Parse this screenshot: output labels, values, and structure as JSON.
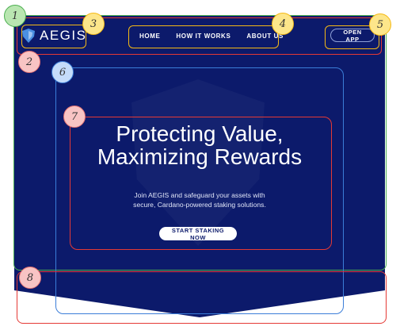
{
  "brand": {
    "name": "AEGIS",
    "logo_icon": "shield-logo-icon"
  },
  "nav": {
    "items": [
      {
        "label": "HOME"
      },
      {
        "label": "HOW IT WORKS"
      },
      {
        "label": "ABOUT US"
      }
    ],
    "open_app_label": "OPEN APP"
  },
  "hero": {
    "headline_line1": "Protecting Value,",
    "headline_line2": "Maximizing Rewards",
    "subtext_line1": "Join AEGIS and safeguard your assets with",
    "subtext_line2": "secure, Cardano-powered staking solutions.",
    "cta_label": "START STAKING NOW"
  },
  "annotations": [
    {
      "label": "1",
      "color": "#4caf50"
    },
    {
      "label": "2",
      "color": "#e53935"
    },
    {
      "label": "3",
      "color": "#f5b915"
    },
    {
      "label": "4",
      "color": "#f5b915"
    },
    {
      "label": "5",
      "color": "#f5b915"
    },
    {
      "label": "6",
      "color": "#3b7dd8"
    },
    {
      "label": "7",
      "color": "#e53935"
    },
    {
      "label": "8",
      "color": "#e53935"
    }
  ],
  "colors": {
    "background": "#0c1a6b",
    "text": "#ffffff",
    "accent_logo": "#4a90e2"
  }
}
